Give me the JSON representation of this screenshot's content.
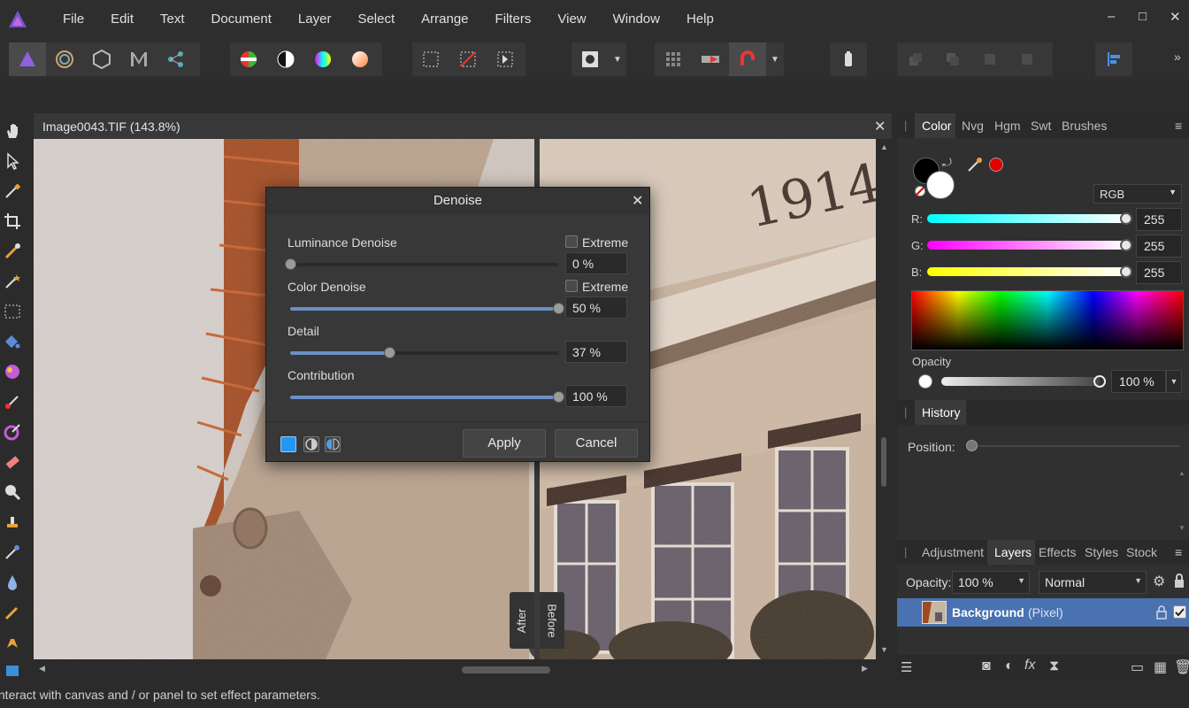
{
  "menu": [
    "File",
    "Edit",
    "Text",
    "Document",
    "Layer",
    "Select",
    "Arrange",
    "Filters",
    "View",
    "Window",
    "Help"
  ],
  "window_controls": {
    "minimize": "–",
    "maximize": "□",
    "close": "✕"
  },
  "document": {
    "title": "Image0043.TIF (143.8%)"
  },
  "canvas": {
    "after_label": "After",
    "before_label": "Before",
    "year_text": "1914"
  },
  "status_text": "Interact with canvas and / or panel to set effect parameters.",
  "dialog": {
    "title": "Denoise",
    "luminance_label": "Luminance Denoise",
    "luminance_value": "0 %",
    "luminance_fraction": 0.0,
    "luminance_extreme": "Extreme",
    "color_label": "Color Denoise",
    "color_value": "50 %",
    "color_fraction": 1.0,
    "color_extreme": "Extreme",
    "detail_label": "Detail",
    "detail_value": "37 %",
    "detail_fraction": 0.37,
    "contribution_label": "Contribution",
    "contribution_value": "100 %",
    "contribution_fraction": 1.0,
    "apply": "Apply",
    "cancel": "Cancel"
  },
  "color_panel": {
    "tabs": [
      "Color",
      "Nvg",
      "Hgm",
      "Swt",
      "Brushes"
    ],
    "active_tab": "Color",
    "mode": "RGB",
    "r_label": "R:",
    "r_value": "255",
    "g_label": "G:",
    "g_value": "255",
    "b_label": "B:",
    "b_value": "255",
    "opacity_label": "Opacity",
    "opacity_value": "100 %"
  },
  "history_panel": {
    "title": "History",
    "position_label": "Position:"
  },
  "layers_panel": {
    "tabs": [
      "Adjustment",
      "Layers",
      "Effects",
      "Styles",
      "Stock"
    ],
    "active_tab": "Layers",
    "opacity_label": "Opacity:",
    "opacity_value": "100 %",
    "blend_mode": "Normal",
    "layer_name": "Background",
    "layer_type": "(Pixel)"
  },
  "colors": {
    "accent": "#6c8fc4",
    "layer_selected": "#4a72b0",
    "primary_red": "#e00000"
  }
}
